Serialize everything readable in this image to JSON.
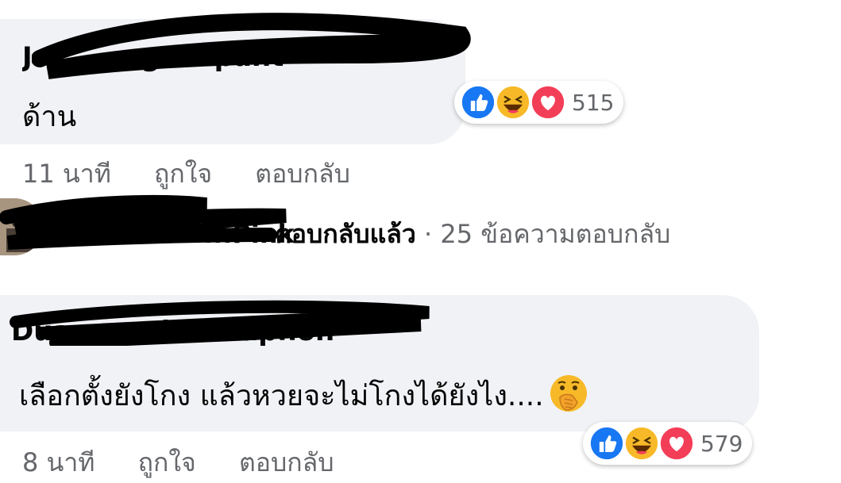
{
  "comment1": {
    "author": "Jo... ...ngsonpant",
    "text": "ด้าน",
    "time": "11 นาที",
    "like_label": "ถูกใจ",
    "reply_label": "ตอบกลับ",
    "reaction_count": "515"
  },
  "replies_summary": {
    "author_suffix": "...Pink",
    "action": "ตอบกลับแล้ว",
    "separator": "·",
    "count_text": "25 ข้อความตอบกลับ"
  },
  "comment2": {
    "author": "Duan... ...hitanaphon",
    "text": "เลือกตั้งยังโกง แล้วหวยจะไม่โกงได้ยังไง....",
    "time": "8 นาที",
    "like_label": "ถูกใจ",
    "reply_label": "ตอบกลับ",
    "reaction_count": "579"
  },
  "reaction_icons": [
    "like-icon",
    "haha-icon",
    "love-icon"
  ],
  "colors": {
    "bubble": "#f0f2f5",
    "meta": "#65676b",
    "like": "#1877f2",
    "love": "#f33e58",
    "haha": "#f7b928"
  }
}
